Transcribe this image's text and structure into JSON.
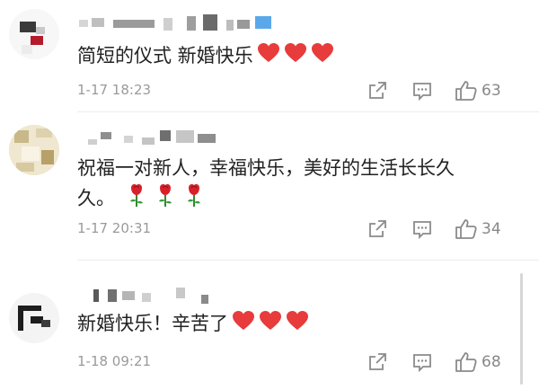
{
  "comments": [
    {
      "text": "简短的仪式 新婚快乐",
      "emoji": [
        "heart",
        "heart",
        "heart"
      ],
      "time": "1-17 18:23",
      "likes": "63"
    },
    {
      "text_line1": "祝福一对新人，幸福快乐，美好的生活长长久",
      "text_line2": "久。",
      "emoji": [
        "rose",
        "rose",
        "rose"
      ],
      "time": "1-17 20:31",
      "likes": "34"
    },
    {
      "text": "新婚快乐！辛苦了",
      "emoji": [
        "heart",
        "heart",
        "heart"
      ],
      "time": "1-18 09:21",
      "likes": "68"
    }
  ],
  "icons": {
    "share": "share-icon",
    "reply": "comment-icon",
    "like": "thumbs-up-icon"
  },
  "colors": {
    "heart": "#e83b3b",
    "rose": "#d8202b",
    "meta": "#9a9a9a",
    "text": "#222222"
  }
}
